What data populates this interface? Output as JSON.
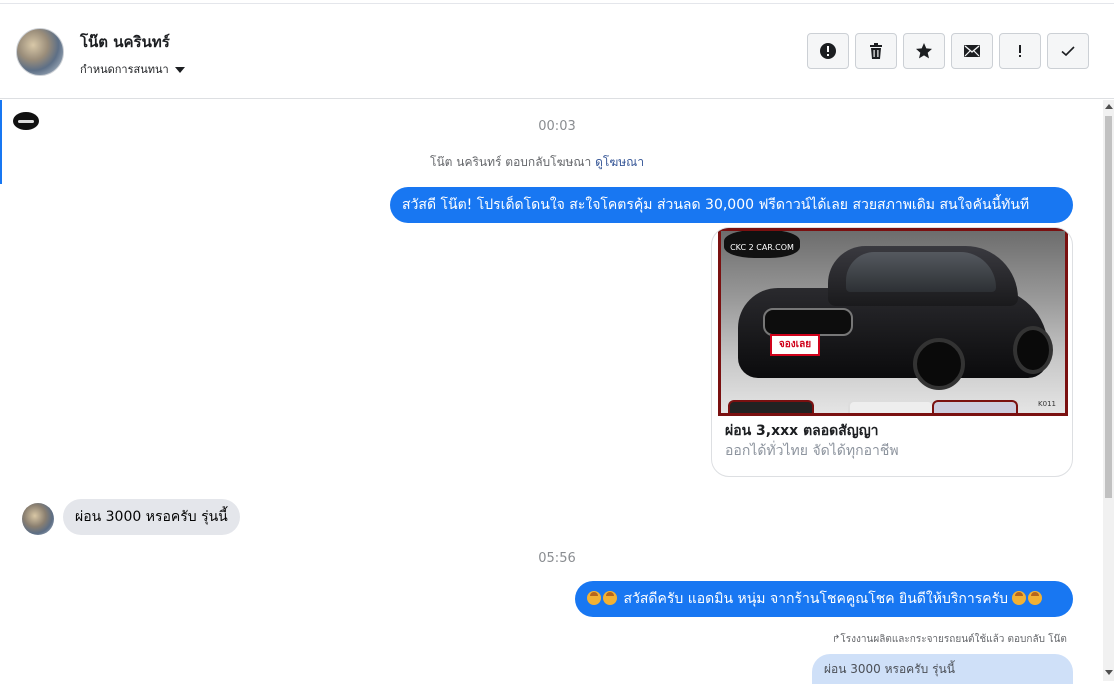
{
  "header": {
    "contact_name": "โน๊ต นครินทร์",
    "subtitle": "กำหนดการสนทนา",
    "toolbar": [
      {
        "icon": "alert-circle-icon",
        "name": "spam-button"
      },
      {
        "icon": "trash-icon",
        "name": "delete-button"
      },
      {
        "icon": "star-icon",
        "name": "star-button"
      },
      {
        "icon": "envelope-icon",
        "name": "mark-unread-button"
      },
      {
        "icon": "exclamation-icon",
        "name": "follow-up-button"
      },
      {
        "icon": "check-icon",
        "name": "done-button"
      }
    ]
  },
  "conversation": {
    "timestamp_1": "00:03",
    "reply_note": {
      "text": "โน๊ต นครินทร์ ตอบกลับโฆษณา",
      "link": "ดูโฆษณา"
    },
    "ad_message": "สวัสดี โน๊ต! โปรเด็ดโดนใจ สะใจโคตรคุ้ม ส่วนลด 30,000 ฟรีดาวน์ได้เลย สวยสภาพเดิม สนใจคันนี้ทันที",
    "ad_card": {
      "image_logo_text": "CKC 2 CAR.COM",
      "image_badge_text": "จองเลย",
      "image_code": "K011",
      "title": "ผ่อน 3,xxx ตลอดสัญญา",
      "subtitle": "ออกได้ทั่วไทย จัดได้ทุกอาชีพ"
    },
    "incoming_message": "ผ่อน 3000 หรอครับ รุ่นนี้",
    "timestamp_2": "05:56",
    "outgoing_message": "สวัสดีครับ แอดมิน หนุ่ม จากร้านโชคคูณโชค ยินดีให้บริการครับ",
    "forward_note": "โรงงานผลิตและกระจายรถยนต์ใช้แล้ว ตอบกลับ โน๊ต",
    "quoted_message": "ผ่อน 3000 หรอครับ รุ่นนี้"
  },
  "colors": {
    "accent": "#1877f2",
    "incoming_bubble": "#e4e6eb",
    "quoted_bubble": "#cfe0f8"
  }
}
